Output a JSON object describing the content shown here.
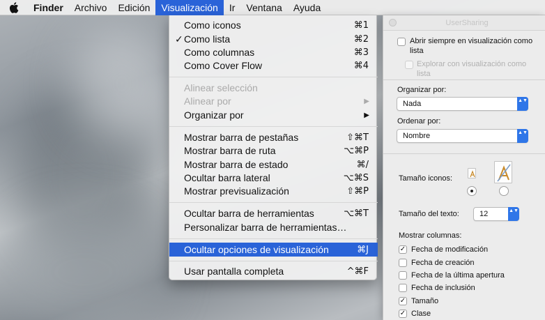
{
  "menubar": {
    "items": [
      "Finder",
      "Archivo",
      "Edición",
      "Visualización",
      "Ir",
      "Ventana",
      "Ayuda"
    ],
    "active": "Visualización"
  },
  "menu": {
    "items": [
      {
        "label": "Como iconos",
        "shortcut": "⌘1",
        "checked": false
      },
      {
        "label": "Como lista",
        "shortcut": "⌘2",
        "checked": true
      },
      {
        "label": "Como columnas",
        "shortcut": "⌘3",
        "checked": false
      },
      {
        "label": "Como Cover Flow",
        "shortcut": "⌘4",
        "checked": false
      },
      {
        "label": "Alinear selección",
        "disabled": true
      },
      {
        "label": "Alinear por",
        "disabled": true,
        "submenu": true
      },
      {
        "label": "Organizar por",
        "submenu": true
      },
      {
        "label": "Mostrar barra de pestañas",
        "shortcut": "⇧⌘T"
      },
      {
        "label": "Mostrar barra de ruta",
        "shortcut": "⌥⌘P"
      },
      {
        "label": "Mostrar barra de estado",
        "shortcut": "⌘/"
      },
      {
        "label": "Ocultar barra lateral",
        "shortcut": "⌥⌘S"
      },
      {
        "label": "Mostrar previsualización",
        "shortcut": "⇧⌘P"
      },
      {
        "label": "Ocultar barra de herramientas",
        "shortcut": "⌥⌘T"
      },
      {
        "label": "Personalizar barra de herramientas…"
      },
      {
        "label": "Ocultar opciones de visualización",
        "shortcut": "⌘J",
        "highlighted": true
      },
      {
        "label": "Usar pantalla completa",
        "shortcut": "^⌘F"
      }
    ],
    "submenu_arrow": "▶"
  },
  "panel": {
    "title": "UserSharing",
    "always_open_label": "Abrir siempre en visualización como lista",
    "browse_label": "Explorar con visualización como lista",
    "organize_label": "Organizar por:",
    "organize_value": "Nada",
    "sort_label": "Ordenar por:",
    "sort_value": "Nombre",
    "icon_size_label": "Tamaño iconos:",
    "icon_size_selected": "small",
    "text_size_label": "Tamaño del texto:",
    "text_size_value": "12",
    "columns_label": "Mostrar columnas:",
    "columns": [
      {
        "label": "Fecha de modificación",
        "checked": true
      },
      {
        "label": "Fecha de creación",
        "checked": false
      },
      {
        "label": "Fecha de la última apertura",
        "checked": false
      },
      {
        "label": "Fecha de inclusión",
        "checked": false
      },
      {
        "label": "Tamaño",
        "checked": true
      },
      {
        "label": "Clase",
        "checked": true
      }
    ],
    "check_glyph": "✓",
    "stepper_glyph": "▲▼",
    "accent_color": "#2f76e8"
  },
  "colors": {
    "menu_highlight": "#2a63d8",
    "disabled_text": "#aaaaaa"
  }
}
